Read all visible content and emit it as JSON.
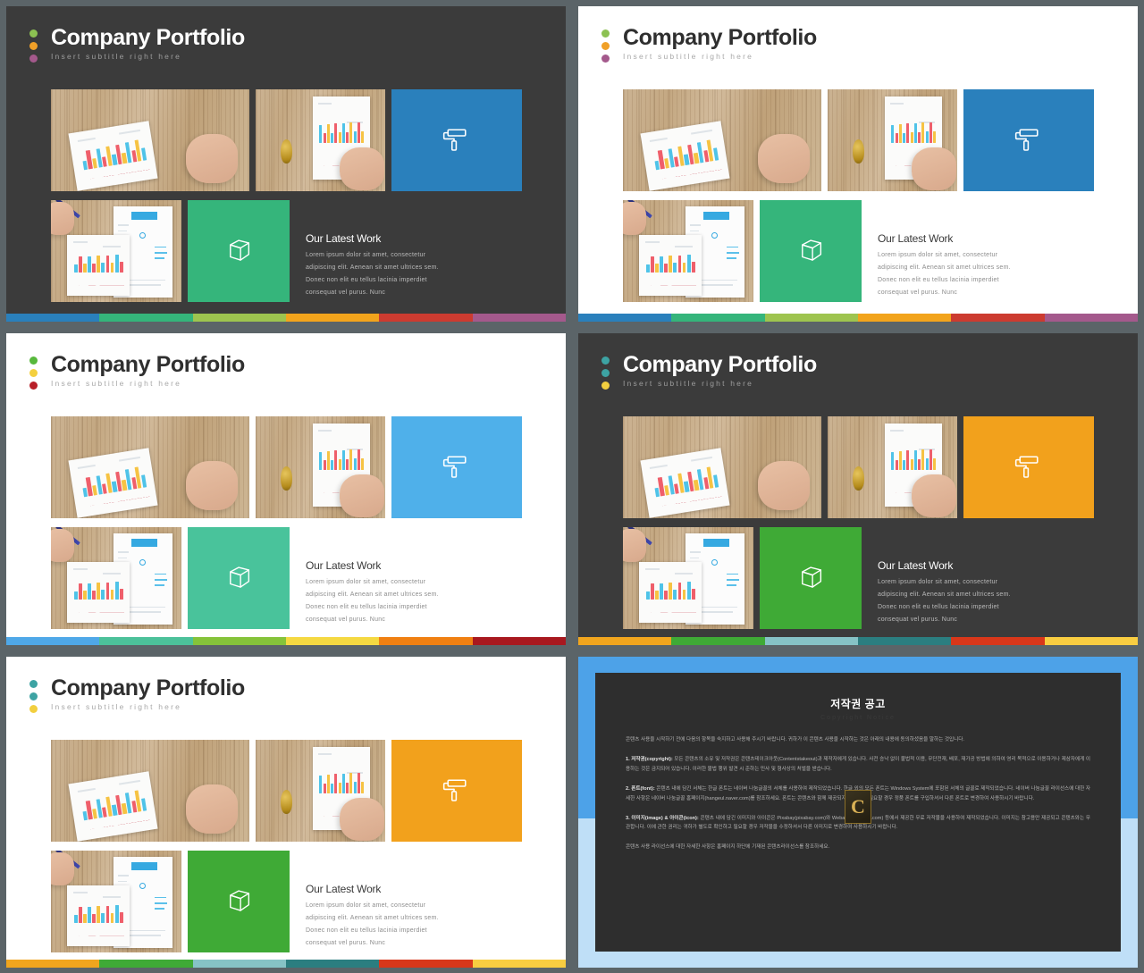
{
  "deck": {
    "slide_count": 6
  },
  "slides": [
    {
      "id": "slide-1",
      "theme": "dark",
      "title": "Company Portfolio",
      "subtitle": "Insert subtitle right here",
      "bullet_colors": [
        "#8cc152",
        "#f0a028",
        "#a4598c"
      ],
      "accent_primary": "#2a80bc",
      "accent_secondary": "#35b57b",
      "latest": {
        "heading": "Our Latest Work",
        "lines": [
          "Lorem ipsum dolor sit amet, consectetur",
          "adipiscing elit.  Aenean sit amet ultrices sem.",
          "Donec non elit eu tellus lacinia imperdiet",
          "consequat vel purus. Nunc"
        ]
      },
      "footer_colors": [
        "#2a80bc",
        "#35b57b",
        "#9ec44f",
        "#f2a41c",
        "#cc3b30",
        "#a4598c"
      ]
    },
    {
      "id": "slide-2",
      "theme": "light",
      "title": "Company Portfolio",
      "subtitle": "Insert subtitle right here",
      "bullet_colors": [
        "#8cc152",
        "#f0a028",
        "#a4598c"
      ],
      "accent_primary": "#2a80bc",
      "accent_secondary": "#35b57b",
      "latest": {
        "heading": "Our Latest Work",
        "lines": [
          "Lorem ipsum dolor sit amet, consectetur",
          "adipiscing elit.  Aenean sit amet ultrices sem.",
          "Donec non elit eu tellus lacinia imperdiet",
          "consequat vel purus. Nunc"
        ]
      },
      "footer_colors": [
        "#2a80bc",
        "#35b57b",
        "#9ec44f",
        "#f2a41c",
        "#cc3b30",
        "#a4598c"
      ]
    },
    {
      "id": "slide-3",
      "theme": "light",
      "title": "Company Portfolio",
      "subtitle": "Insert subtitle right here",
      "bullet_colors": [
        "#57b83c",
        "#f4d03f",
        "#b81f28"
      ],
      "accent_primary": "#4fb0ea",
      "accent_secondary": "#49c39b",
      "latest": {
        "heading": "Our Latest Work",
        "lines": [
          "Lorem ipsum dolor sit amet, consectetur",
          "adipiscing elit.  Aenean sit amet ultrices sem.",
          "Donec non elit eu tellus lacinia imperdiet",
          "consequat vel purus. Nunc"
        ]
      },
      "footer_colors": [
        "#4fa8e8",
        "#4cc19a",
        "#85c33a",
        "#f5d942",
        "#f08012",
        "#a8181f"
      ]
    },
    {
      "id": "slide-4",
      "theme": "dark",
      "title": "Company Portfolio",
      "subtitle": "Insert subtitle right here",
      "bullet_colors": [
        "#3da3a3",
        "#3da3a3",
        "#f2cf3f"
      ],
      "accent_primary": "#f2a11c",
      "accent_secondary": "#3faa36",
      "latest": {
        "heading": "Our Latest Work",
        "lines": [
          "Lorem ipsum dolor sit amet, consectetur",
          "adipiscing elit.  Aenean sit amet ultrices sem.",
          "Donec non elit eu tellus lacinia imperdiet",
          "consequat vel purus. Nunc"
        ]
      },
      "footer_colors": [
        "#f0a51e",
        "#3faa36",
        "#86c3c6",
        "#2b7e80",
        "#d8371a",
        "#f8cd41"
      ]
    },
    {
      "id": "slide-5",
      "theme": "light",
      "title": "Company Portfolio",
      "subtitle": "Insert subtitle right here",
      "bullet_colors": [
        "#3da3a3",
        "#3da3a3",
        "#f2cf3f"
      ],
      "accent_primary": "#f2a11c",
      "accent_secondary": "#3faa36",
      "latest": {
        "heading": "Our Latest Work",
        "lines": [
          "Lorem ipsum dolor sit amet, consectetur",
          "adipiscing elit.  Aenean sit amet ultrices sem.",
          "Donec non elit eu tellus lacinia imperdiet",
          "consequat vel purus. Nunc"
        ]
      },
      "footer_colors": [
        "#f0a51e",
        "#3faa36",
        "#86c3c6",
        "#2b7e80",
        "#d8371a",
        "#f8cd41"
      ]
    }
  ],
  "copyright_slide": {
    "id": "slide-6",
    "title": "저작권 공고",
    "subtitle": "Copyright Notice",
    "badge_letter": "C",
    "intro": "콘텐츠 사용을 시작하기 전에 다음의 항목을 숙지하고 사용해 주시기 바랍니다. 귀하가 이 콘텐츠 사용을 시작하는 것은 아래의 내용에 동의하셨음을 말하는 것입니다.",
    "paragraphs": [
      {
        "label": "1. 저작권(copyright):",
        "text": " 모든 콘텐츠의 소유 및 저작권은 콘텐츠테이크아웃(Contentstakeout)과 제작자에게 있습니다. 사전 승낙 없이 불법적 이용, 무단전재, 배포, 재가공 방법에 의하여 영리 목적으로 이용하거나 제삼자에게 이용하는 것은 금지되어 있습니다. 이러한 불법 행위 발견 시 준하는 민사 및 형사상의 처벌을 받습니다."
      },
      {
        "label": "2. 폰트(font):",
        "text": " 콘텐츠 내에 담긴 서체는 한글 폰트는 네이버 나눔글꼴의 서체를 사용하여 제작되었습니다. 한글 외의 모든 폰트는 Windows System에 포함된 서체의 글꼴로 제작되었습니다. 네이버 나눔글꼴 라이선스에 대한 자세한 사항은 네이버 나눔글꼴 홈페이지(hangeul.naver.com)를 참조하세요. 폰트는 콘텐츠와 함께 제공되지 않으므로, 필요할 경우 정품 폰트를 구입하셔서 다른 폰트로 변경하여 사용하시기 바랍니다."
      },
      {
        "label": "3. 이미지(image) & 아이콘(icon):",
        "text": " 콘텐츠 내에 담긴 이미지와 아이콘은 Pixabay(pixabay.com)와 Webalys(webalys.com) 등에서 제공한 무료 저작물을 사용하여 제작되었습니다. 이미지는 참고용만 제공되고 콘텐츠와는 무관합니다. 이에 관한 권리는 귀하가 별도로 확인하고 필요할 경우 저작물을 수정하셔서 다른 이미지로 변경하여 사용하시기 바랍니다."
      }
    ],
    "closing": "콘텐츠 사용 라이선스에 대한 자세한 사항은 홈페이지 하단에 기재된 콘텐츠라이선스를 참조하세요."
  }
}
